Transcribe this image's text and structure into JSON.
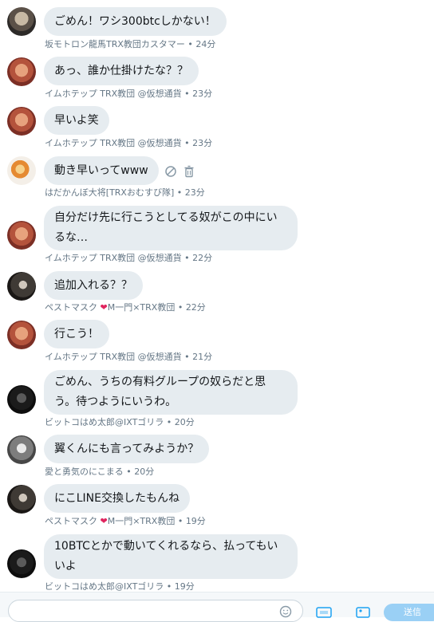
{
  "messages": [
    {
      "text": "ごめん！ワシ300btcしかない！",
      "author": "坂モトロン龍馬TRX教団カスタマー",
      "time": "24分",
      "avatar": "avatar-samurai"
    },
    {
      "text": "あっ、誰か仕掛けたな？？",
      "author": "イムホテップ TRX教団 @仮想通貨",
      "time": "23分",
      "avatar": "avatar-imhotep"
    },
    {
      "text": "早いよ笑",
      "author": "イムホテップ TRX教団 @仮想通貨",
      "time": "23分",
      "avatar": "avatar-imhotep"
    },
    {
      "text": "動き早いってwww",
      "author": "はだかんぼ大将[TRXおむすび隊]",
      "time": "23分",
      "avatar": "avatar-hadaka"
    },
    {
      "text_line1": "自分だけ先に行こうとしてる奴がこの中にい",
      "text_line2": "るな…",
      "author": "イムホテップ TRX教団 @仮想通貨",
      "time": "22分",
      "avatar": "avatar-imhotep"
    },
    {
      "text": "追加入れる？？",
      "author_prefix": "ペストマスク",
      "author_suffix": "M一門×TRX教団",
      "time": "22分",
      "avatar": "avatar-mask"
    },
    {
      "text": "行こう！",
      "author": "イムホテップ TRX教団 @仮想通貨",
      "time": "21分",
      "avatar": "avatar-imhotep"
    },
    {
      "text_line1": "ごめん、うちの有料グループの奴らだと思",
      "text_line2": "う。待つようにいうわ。",
      "author": "ビットコはめ太郎@IXTゴリラ",
      "time": "20分",
      "avatar": "avatar-bitko"
    },
    {
      "text": "翼くんにも言ってみようか？",
      "author": "愛と勇気のにこまる",
      "time": "20分",
      "avatar": "avatar-kokoru"
    },
    {
      "text": "にこLINE交換したもんね",
      "author_prefix": "ペストマスク",
      "author_suffix": "M一門×TRX教団",
      "time": "19分",
      "avatar": "avatar-mask"
    },
    {
      "text_line1": "10BTCとかで動いてくれるなら、払ってもい",
      "text_line2": "いよ",
      "author": "ビットコはめ太郎@IXTゴリラ",
      "time": "19分",
      "avatar": "avatar-bitko"
    }
  ],
  "separator": " • ",
  "composer": {
    "send_label": "送信"
  },
  "colors": {
    "bubble": "#e6ecf0",
    "meta": "#657786",
    "send": "#9ad0f5",
    "heart": "#e0245e"
  },
  "icons": [
    "block-icon",
    "trash-icon",
    "gif-icon",
    "image-icon",
    "emoji-icon",
    "heart-icon"
  ]
}
